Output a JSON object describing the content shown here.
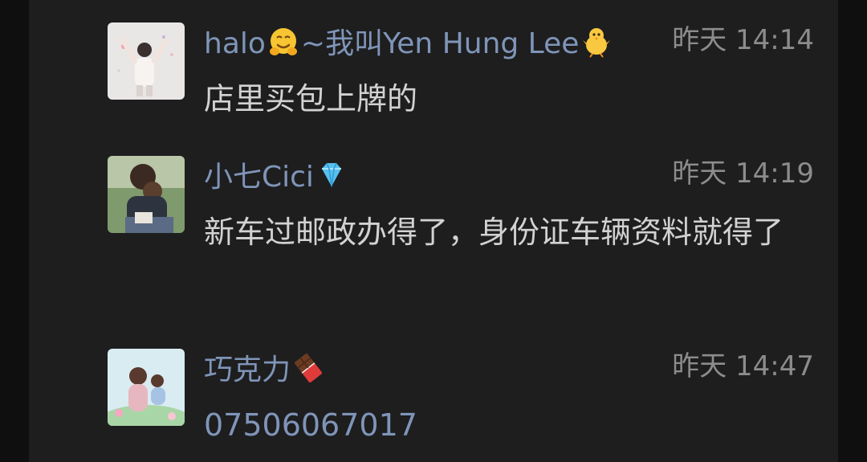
{
  "comments": [
    {
      "name_prefix": "halo",
      "name_mid": "~我叫Yen Hung Lee",
      "time": "昨天 14:14",
      "text": "店里买包上牌的",
      "icons": [
        "hugging-face-icon",
        "baby-chick-icon"
      ]
    },
    {
      "name_prefix": "小七Cici",
      "time": "昨天 14:19",
      "text": "新车过邮政办得了，身份证车辆资料就得了",
      "icons": [
        "gem-icon"
      ]
    },
    {
      "name_prefix": "巧克力",
      "time": "昨天 14:47",
      "text": "07506067017",
      "icons": [
        "chocolate-bar-icon"
      ]
    }
  ],
  "colors": {
    "background": "#1e1e1f",
    "outer": "#0f0f10",
    "name": "#7f95b8",
    "text": "#d2d2d2",
    "time": "#8c8c8c",
    "phone_link": "#7f95b8"
  }
}
